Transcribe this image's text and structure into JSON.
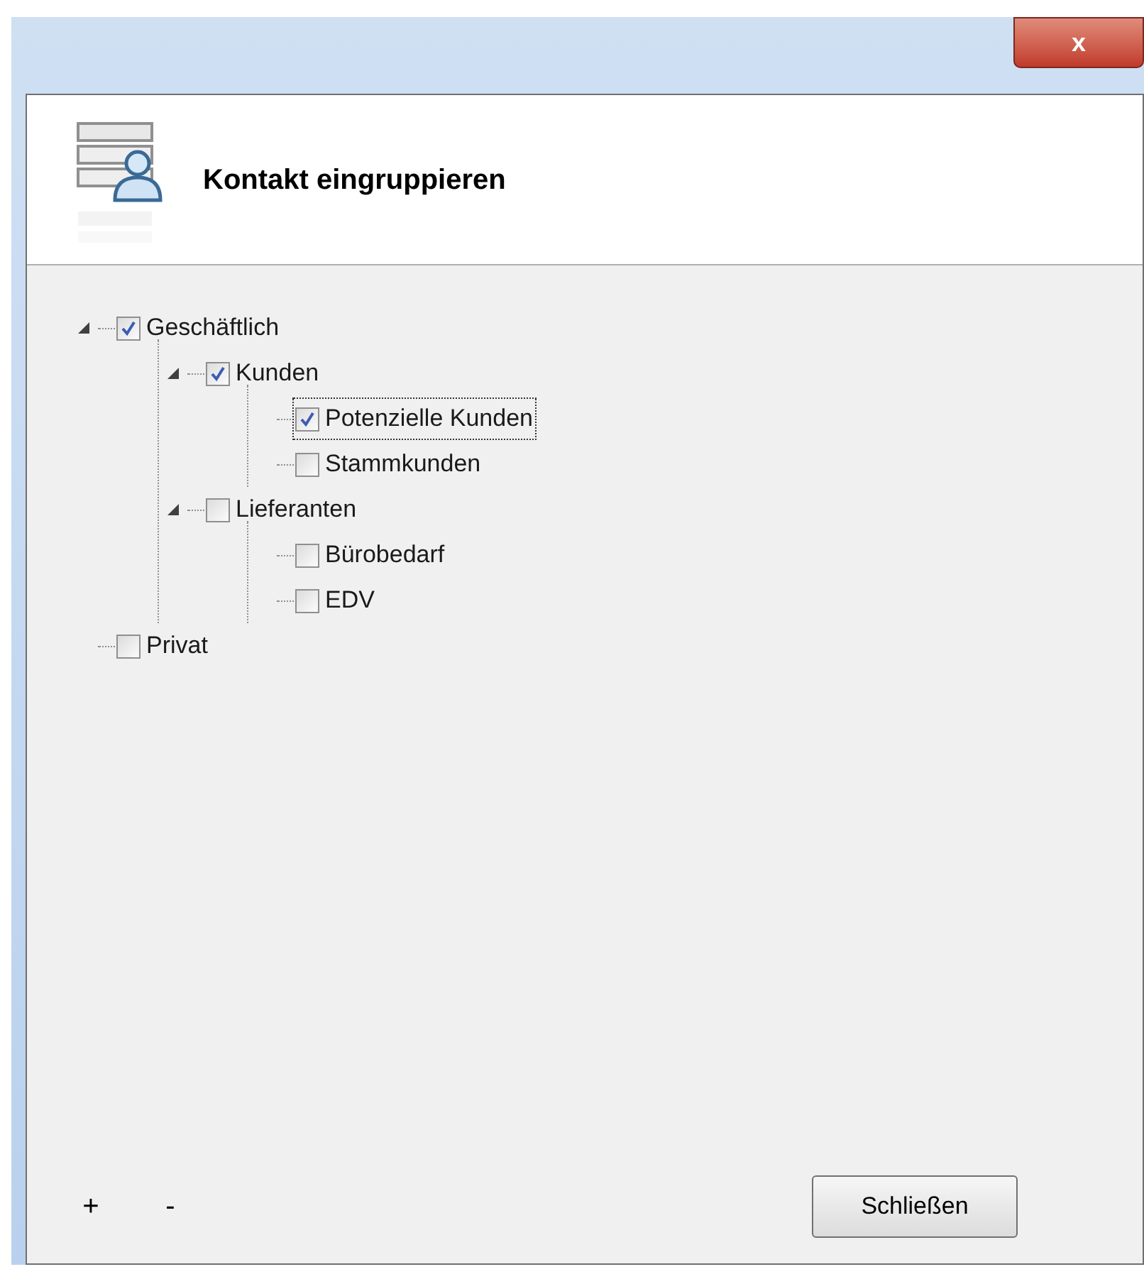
{
  "window": {
    "close_button": "x"
  },
  "header": {
    "title": "Kontakt eingruppieren"
  },
  "tree": [
    {
      "label": "Geschäftlich",
      "checked": true,
      "expanded": true,
      "selected": false,
      "children": [
        {
          "label": "Kunden",
          "checked": true,
          "expanded": true,
          "selected": false,
          "children": [
            {
              "label": "Potenzielle Kunden",
              "checked": true,
              "selected": true
            },
            {
              "label": "Stammkunden",
              "checked": false,
              "selected": false
            }
          ]
        },
        {
          "label": "Lieferanten",
          "checked": false,
          "expanded": true,
          "selected": false,
          "children": [
            {
              "label": "Bürobedarf",
              "checked": false,
              "selected": false
            },
            {
              "label": "EDV",
              "checked": false,
              "selected": false
            }
          ]
        }
      ]
    },
    {
      "label": "Privat",
      "checked": false,
      "selected": false
    }
  ],
  "footer": {
    "add": "+",
    "remove": "-",
    "close": "Schließen"
  }
}
